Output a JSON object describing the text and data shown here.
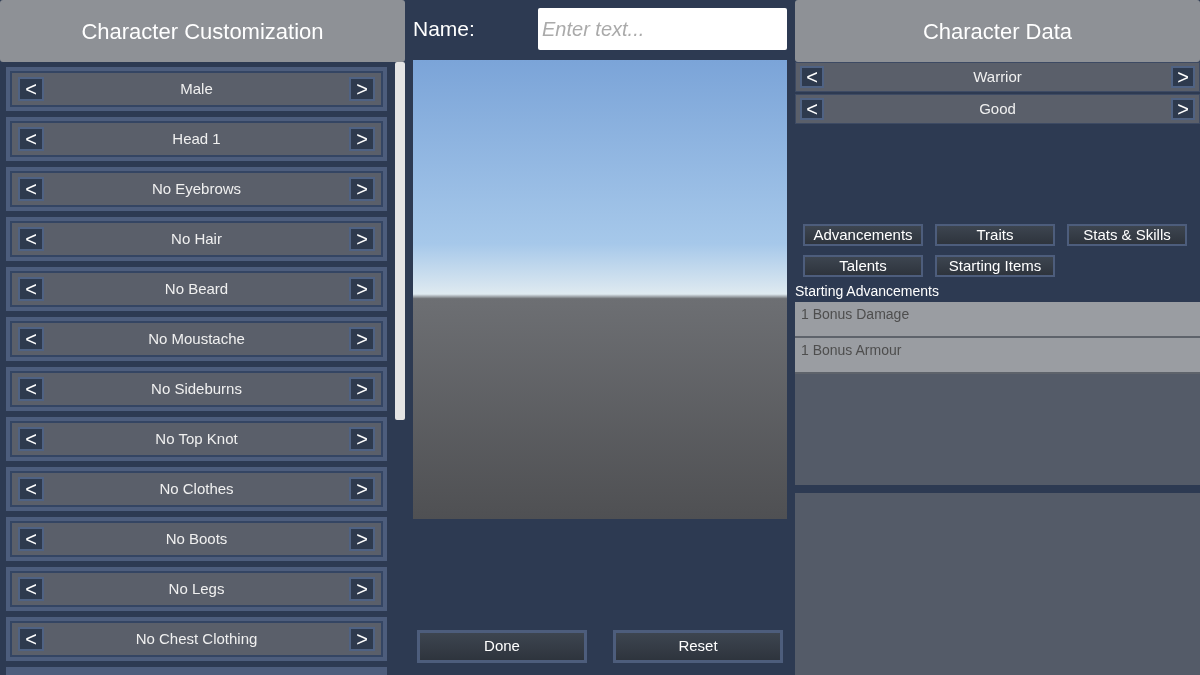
{
  "customization": {
    "title": "Character Customization",
    "options": [
      {
        "prev": "<",
        "value": "Male",
        "next": ">"
      },
      {
        "prev": "<",
        "value": "Head 1",
        "next": ">"
      },
      {
        "prev": "<",
        "value": "No Eyebrows",
        "next": ">"
      },
      {
        "prev": "<",
        "value": "No Hair",
        "next": ">"
      },
      {
        "prev": "<",
        "value": "No Beard",
        "next": ">"
      },
      {
        "prev": "<",
        "value": "No Moustache",
        "next": ">"
      },
      {
        "prev": "<",
        "value": "No Sideburns",
        "next": ">"
      },
      {
        "prev": "<",
        "value": "No Top Knot",
        "next": ">"
      },
      {
        "prev": "<",
        "value": "No Clothes",
        "next": ">"
      },
      {
        "prev": "<",
        "value": "No Boots",
        "next": ">"
      },
      {
        "prev": "<",
        "value": "No Legs",
        "next": ">"
      },
      {
        "prev": "<",
        "value": "No Chest Clothing",
        "next": ">"
      }
    ]
  },
  "name_field": {
    "label": "Name:",
    "placeholder": "Enter text..."
  },
  "actions": [
    "Done",
    "Reset"
  ],
  "character_data": {
    "title": "Character Data",
    "selectors": [
      {
        "prev": "<",
        "value": "Warrior",
        "next": ">"
      },
      {
        "prev": "<",
        "value": "Good",
        "next": ">"
      }
    ],
    "tabs": [
      "Advancements",
      "Traits",
      "Stats & Skills",
      "Talents",
      "Starting Items"
    ],
    "section_label": "Starting Advancements",
    "items": [
      "1 Bonus Damage",
      "1 Bonus Armour"
    ]
  }
}
